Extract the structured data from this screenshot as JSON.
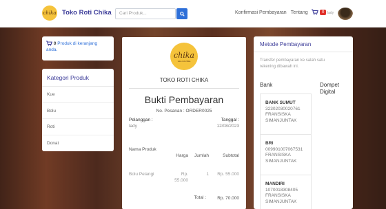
{
  "header": {
    "logo_text": "chika",
    "brand": "Toko Roti Chika",
    "search_placeholder": "Cari Produk...",
    "nav": [
      "Konfirmasi Pembayaran",
      "Tentang"
    ],
    "cart_count": "0",
    "user": "lady"
  },
  "cart_summary": {
    "count": "0",
    "text": "Produk di keranjang anda."
  },
  "categories": {
    "title": "Kategori Produk",
    "items": [
      "Kue",
      "Bolu",
      "Roti",
      "Donat"
    ]
  },
  "receipt": {
    "logo_text": "chika",
    "logo_subtext": "toko roti chika",
    "store": "TOKO ROTI CHIKA",
    "title": "Bukti Pembayaran",
    "order_label": "No. Pesanan :",
    "order_no": "ORDER0025",
    "customer_label": "Pelanggan :",
    "customer": "lady",
    "date_label": "Tanggal :",
    "date": "12/08/2023",
    "columns": [
      "Nama Produk",
      "Harga",
      "Jumlah",
      "Subtotal"
    ],
    "rows": [
      {
        "name": "Bolu Pelangi",
        "price": "Rp. 55.000",
        "qty": "1",
        "subtotal": "Rp. 55.000"
      }
    ],
    "total_label": "Total :",
    "total": "Rp. 70.000"
  },
  "payment": {
    "title": "Metode Pembayaran",
    "description": "Transfer pembayaran ke salah satu rekening dibawah ini.",
    "bank_heading": "Bank",
    "wallet_heading": "Dompet Digital",
    "banks": [
      {
        "name": "BANK SUMUT",
        "number": "32302030020761",
        "holder": "FRANSISKA SIMANJUNTAK"
      },
      {
        "name": "BRI",
        "number": "009901007067531",
        "holder": "FRANSISKA SIMANJUNTAK"
      },
      {
        "name": "MANDIRI",
        "number": "1070018308405",
        "holder": "FRANSISKA SIMANJUNTAK"
      }
    ]
  },
  "colors": {
    "brand": "#3b3b98",
    "accent": "#2d6fd8",
    "logo": "#f5c33b",
    "badge": "#e0302a"
  }
}
